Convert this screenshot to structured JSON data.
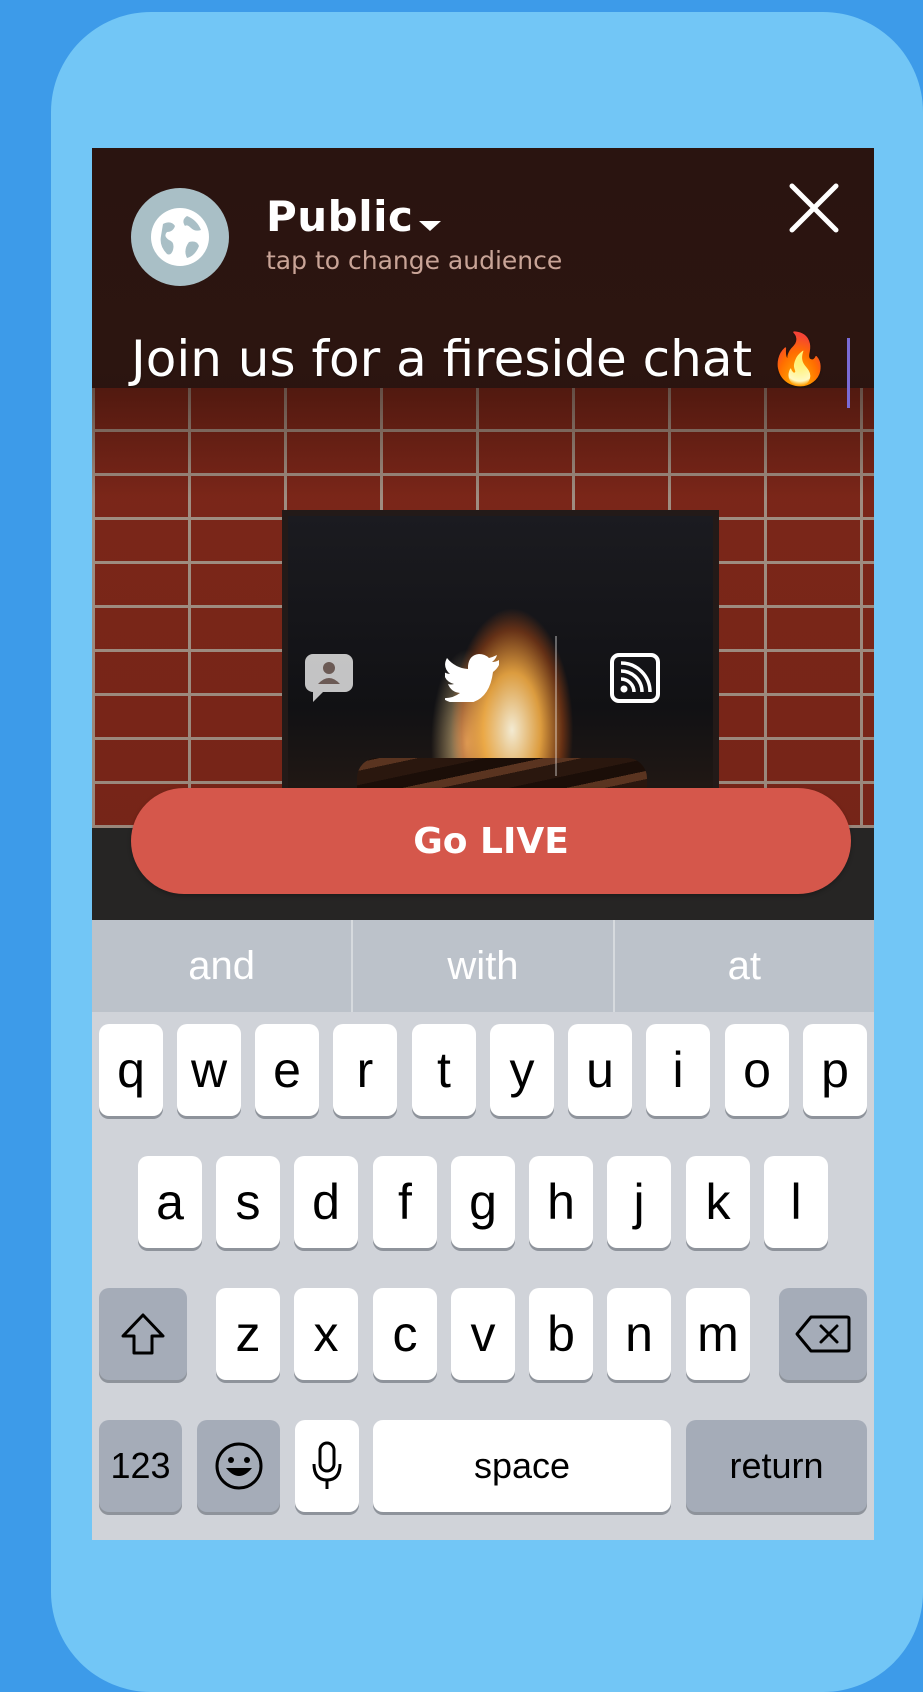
{
  "audience": {
    "title": "Public",
    "subtitle": "tap to change audience"
  },
  "broadcast": {
    "caption": "Join us for a fireside chat 🔥",
    "go_live_label": "Go LIVE"
  },
  "predictive": [
    "and",
    "with",
    "at"
  ],
  "keyboard": {
    "row1": [
      "q",
      "w",
      "e",
      "r",
      "t",
      "y",
      "u",
      "i",
      "o",
      "p"
    ],
    "row2": [
      "a",
      "s",
      "d",
      "f",
      "g",
      "h",
      "j",
      "k",
      "l"
    ],
    "row3": [
      "z",
      "x",
      "c",
      "v",
      "b",
      "n",
      "m"
    ],
    "numbers_label": "123",
    "space_label": "space",
    "return_label": "return"
  },
  "colors": {
    "go_live": "#d5574b",
    "frame": "#72c6f6",
    "background": "#3d9be9"
  },
  "icons": {
    "audience": "globe-icon",
    "close": "close-icon",
    "private_share": "private-chat-icon",
    "twitter": "twitter-bird-icon",
    "cast": "cast-icon",
    "shift": "shift-icon",
    "delete": "backspace-icon",
    "emoji": "emoji-icon",
    "mic": "microphone-icon"
  }
}
